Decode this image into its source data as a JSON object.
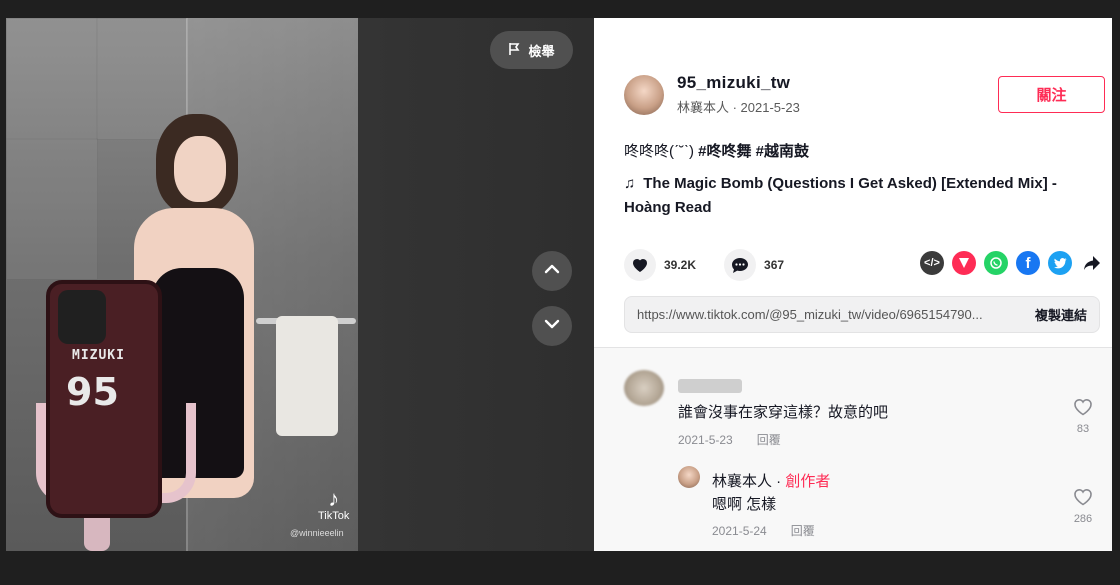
{
  "video": {
    "report_label": "檢舉",
    "watermark_brand": "TikTok",
    "watermark_user": "@winnieeelin",
    "phone_case_name": "MIZUKI",
    "phone_case_number": "95"
  },
  "navigation": {
    "up_icon": "chevron-up-icon",
    "down_icon": "chevron-down-icon"
  },
  "author": {
    "username": "95_mizuki_tw",
    "nickname": "林襄本人",
    "date": "2021-5-23",
    "nick_date": "林襄本人 · 2021-5-23",
    "follow_label": "關注"
  },
  "caption": {
    "text": "咚咚咚(ˊ˘ˋ)",
    "hashtags": "#咚咚舞 #越南鼓"
  },
  "music": {
    "title": "The Magic Bomb (Questions I Get Asked) [Extended Mix] - Hoàng Read"
  },
  "stats": {
    "likes": "39.2K",
    "comments": "367"
  },
  "share": {
    "icons": [
      "embed-icon",
      "send-to-friend-icon",
      "whatsapp-icon",
      "facebook-icon",
      "twitter-icon",
      "share-arrow-icon"
    ],
    "colors": {
      "embed": "#3b3b3b",
      "send": "#fe2c55",
      "whatsapp": "#25d366",
      "facebook": "#1877f2",
      "twitter": "#1da1f2",
      "arrow": "#161823"
    }
  },
  "link": {
    "url": "https://www.tiktok.com/@95_mizuki_tw/video/6965154790...",
    "copy_label": "複製連結"
  },
  "comments": [
    {
      "text": "誰會沒事在家穿這樣？故意的吧",
      "date": "2021-5-23",
      "reply_label": "回覆",
      "likes": "83",
      "reply": {
        "name": "林襄本人",
        "separator": " · ",
        "badge": "創作者",
        "text": "嗯啊 怎樣",
        "date": "2021-5-24",
        "reply_label": "回覆",
        "likes": "286"
      }
    }
  ],
  "colors": {
    "accent": "#fe2c55",
    "text": "#161823",
    "muted": "#8a8b91"
  }
}
